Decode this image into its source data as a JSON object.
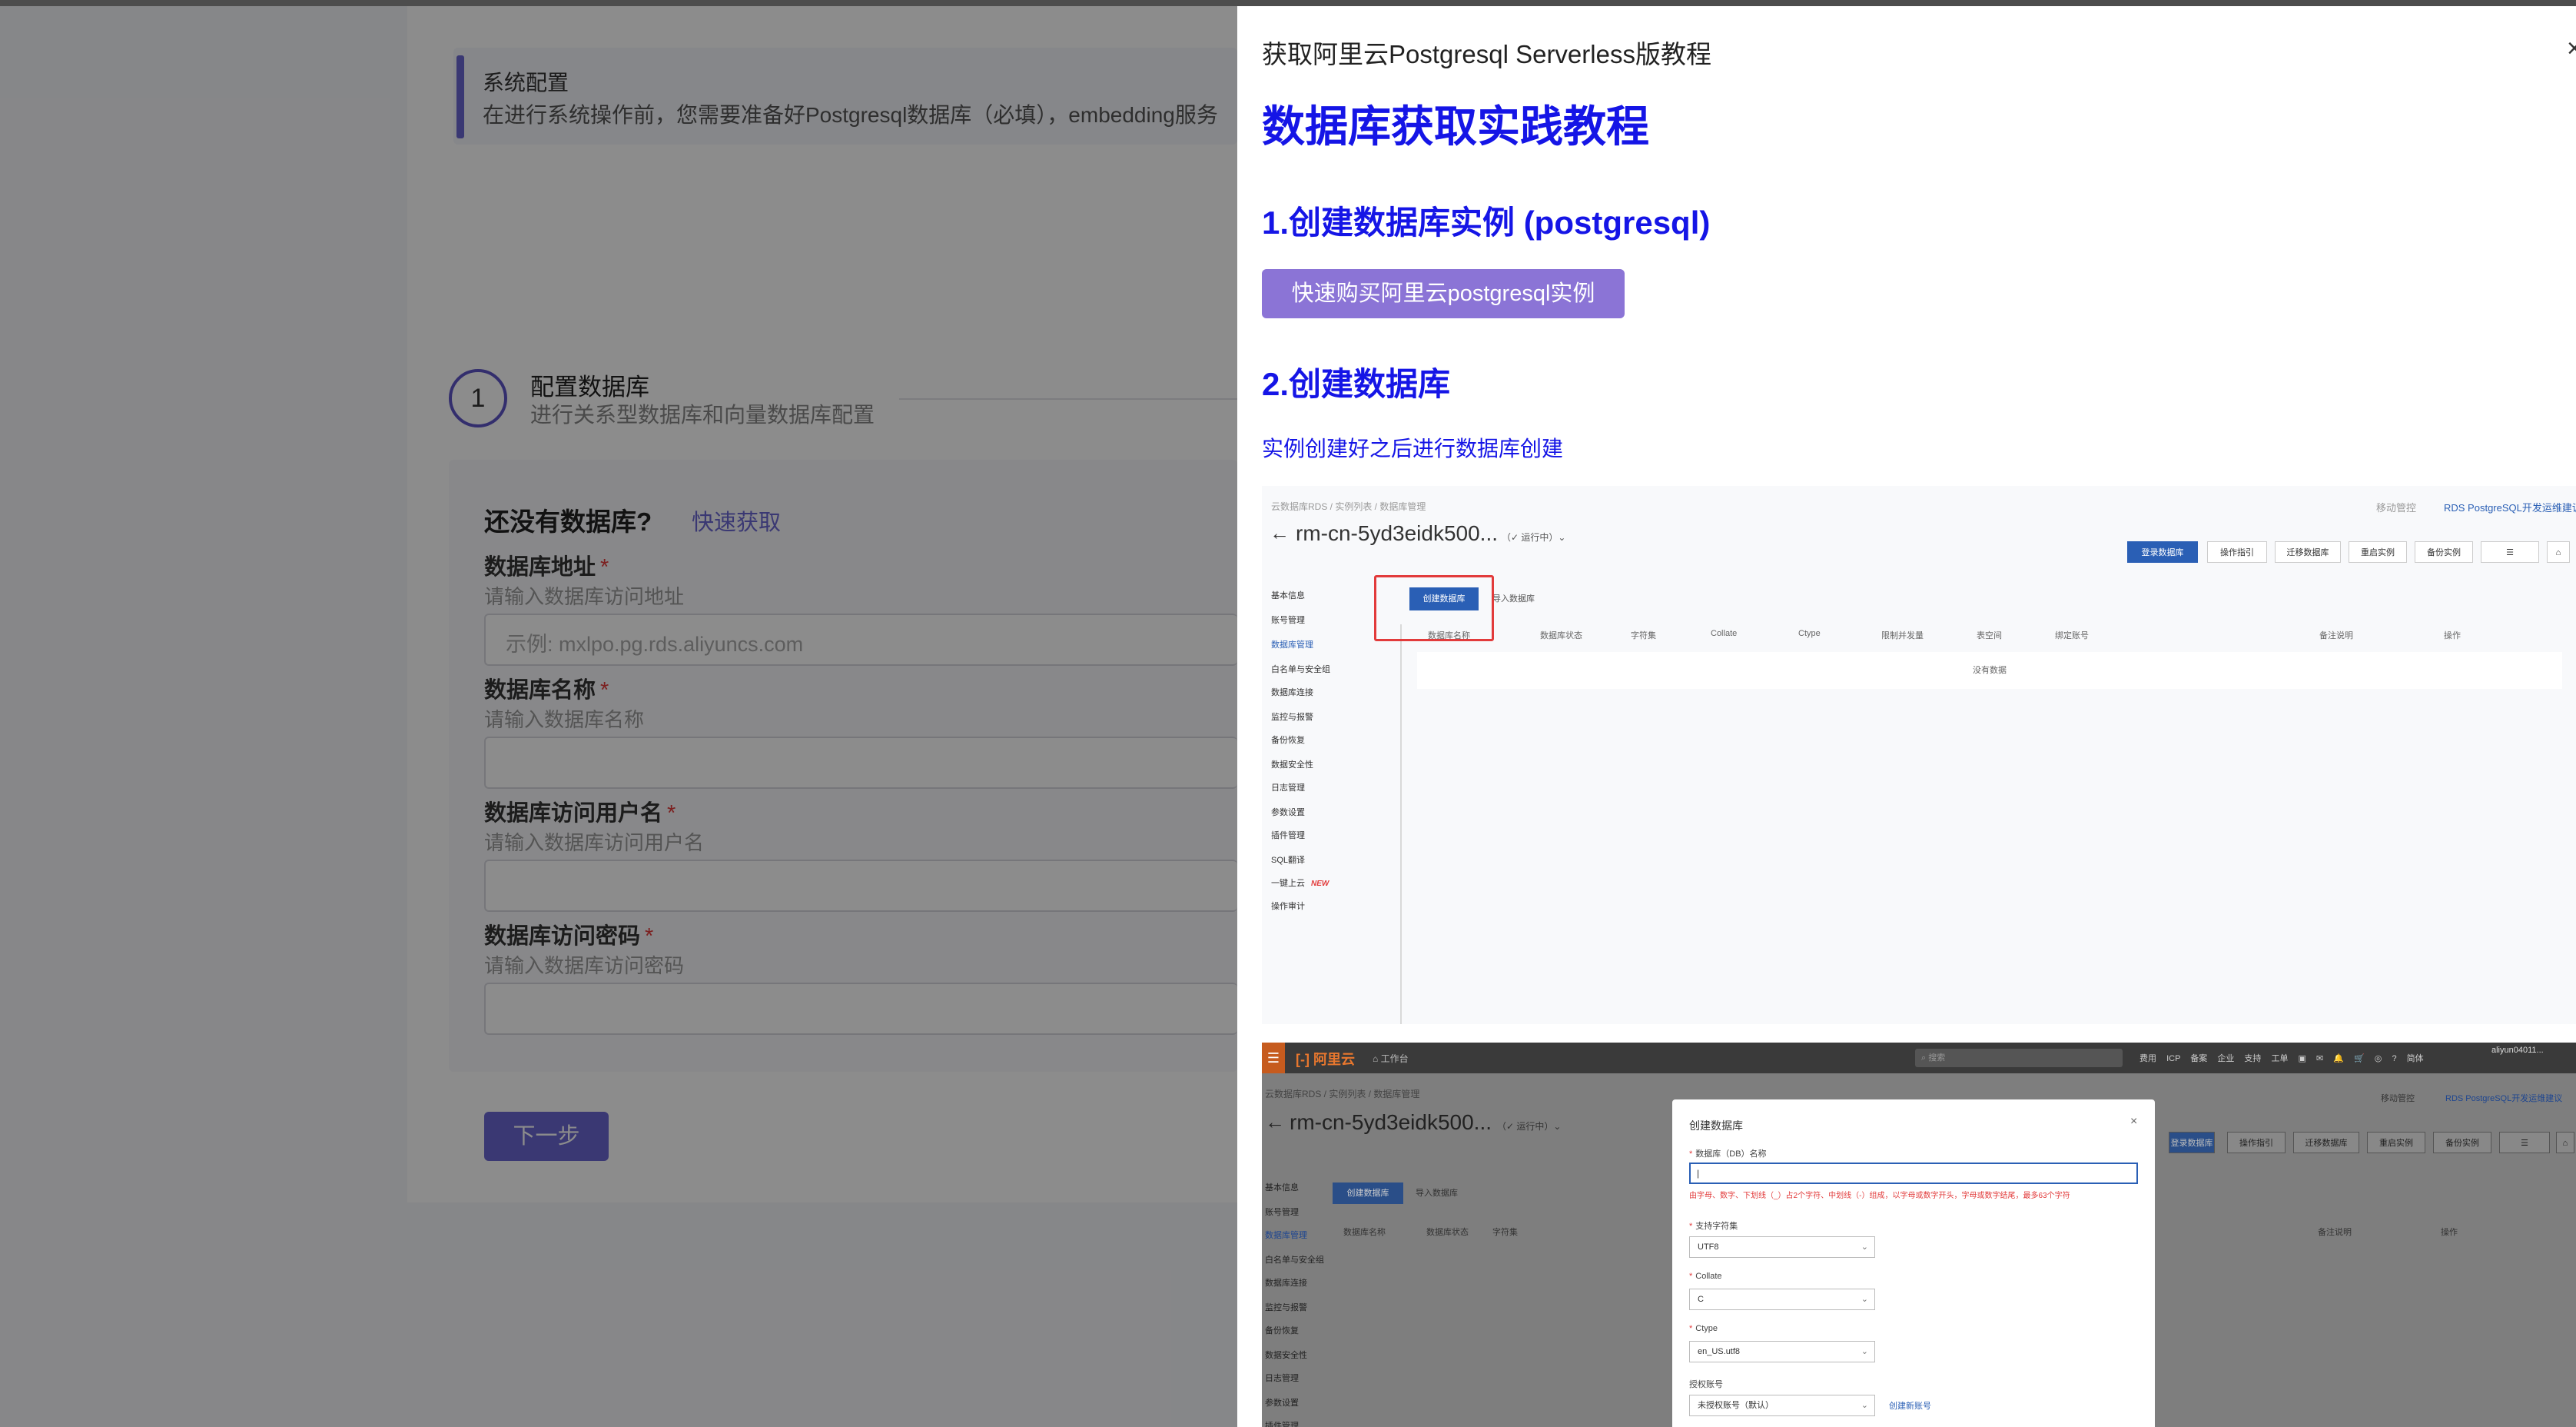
{
  "background": {
    "system_alert": {
      "title": "系统配置",
      "text": "在进行系统操作前，您需要准备好Postgresql数据库（必填），embedding服务"
    },
    "step": {
      "number": "1",
      "title": "配置数据库",
      "subtitle": "进行关系型数据库和向量数据库配置"
    },
    "form": {
      "no_db_prompt": "还没有数据库?",
      "quick_get_link": "快速获取",
      "fields": [
        {
          "label": "数据库地址",
          "required": "*",
          "hint": "请输入数据库访问地址",
          "placeholder": "示例: mxlpo.pg.rds.aliyuncs.com"
        },
        {
          "label": "数据库名称",
          "required": "*",
          "hint": "请输入数据库名称",
          "placeholder": ""
        },
        {
          "label": "数据库访问用户名",
          "required": "*",
          "hint": "请输入数据库访问用户名",
          "placeholder": ""
        },
        {
          "label": "数据库访问密码",
          "required": "*",
          "hint": "请输入数据库访问密码",
          "placeholder": ""
        }
      ],
      "next_button": "下一步"
    }
  },
  "drawer": {
    "title": "获取阿里云Postgresql Serverless版教程",
    "close_glyph": "×",
    "heading": "数据库获取实践教程",
    "section1_title": "1.创建数据库实例 (postgresql)",
    "buy_button": "快速购买阿里云postgresql实例",
    "section2_title": "2.创建数据库",
    "section2_text": "实例创建好之后进行数据库创建",
    "screenshot1": {
      "breadcrumb": "云数据库RDS  /  实例列表  /  数据库管理",
      "top_links": [
        "移动管控",
        "RDS PostgreSQL开发运维建议"
      ],
      "instance_name": "rm-cn-5yd3eidk500...",
      "instance_status": "（✓ 运行中）⌄",
      "action_buttons": [
        "登录数据库",
        "操作指引",
        "迁移数据库",
        "重启实例",
        "备份实例",
        "☰",
        "⌂"
      ],
      "sidebar": [
        "基本信息",
        "账号管理",
        "数据库管理",
        "白名单与安全组",
        "数据库连接",
        "监控与报警",
        "备份恢复",
        "数据安全性",
        "日志管理",
        "参数设置",
        "插件管理",
        "SQL翻译",
        "一键上云",
        "操作审计"
      ],
      "new_badge": "NEW",
      "create_db_button": "创建数据库",
      "import_db_button": "导入数据库",
      "columns": [
        "数据库名称",
        "数据库状态",
        "字符集",
        "Collate",
        "Ctype",
        "限制并发量",
        "表空间",
        "绑定账号",
        "备注说明",
        "操作"
      ],
      "empty_text": "没有数据"
    },
    "screenshot2": {
      "menu_glyph": "☰",
      "logo": "[-] 阿里云",
      "workspace": "⌂ 工作台",
      "search_placeholder": "⌕ 搜索",
      "nav_items": [
        "费用",
        "ICP 备案",
        "企业",
        "支持",
        "工单",
        "▣",
        "✉",
        "🔔",
        "🛒",
        "◎",
        "?",
        "简体"
      ],
      "user": "aliyun04011...",
      "breadcrumb": "云数据库RDS  /  实例列表  /  数据库管理",
      "instance_name": "rm-cn-5yd3eidk500...",
      "instance_status": "（✓ 运行中）⌄",
      "top_links": [
        "移动管控",
        "RDS PostgreSQL开发运维建议"
      ],
      "action_buttons": [
        "登录数据库",
        "操作指引",
        "迁移数据库",
        "重启实例",
        "备份实例",
        "☰",
        "⌂"
      ],
      "sidebar": [
        "基本信息",
        "账号管理",
        "数据库管理",
        "白名单与安全组",
        "数据库连接",
        "监控与报警",
        "备份恢复",
        "数据安全性",
        "日志管理",
        "参数设置",
        "插件管理"
      ],
      "create_db_button": "创建数据库",
      "import_db_button": "导入数据库",
      "columns": [
        "数据库名称",
        "数据库状态",
        "字符集",
        "备注说明",
        "操作"
      ],
      "modal": {
        "title": "创建数据库",
        "close_glyph": "×",
        "db_name_label": "数据库（DB）名称",
        "db_name_value": "|",
        "db_name_rule": "由字母、数字、下划线（_）占2个字符、中划线（-）组成，以字母或数字开头，字母或数字结尾，最多63个字符",
        "charset_label": "支持字符集",
        "charset_value": "UTF8",
        "collate_label": "Collate",
        "collate_value": "C",
        "ctype_label": "Ctype",
        "ctype_value": "en_US.utf8",
        "account_label": "授权账号",
        "account_value": "未授权账号（默认）",
        "create_account_link": "创建新账号",
        "required_mark": "*",
        "chevron": "⌄"
      }
    }
  }
}
